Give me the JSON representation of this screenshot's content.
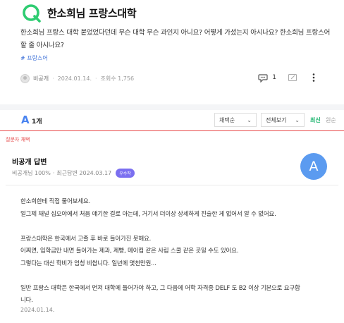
{
  "question": {
    "title": "한소희님 프랑스대학",
    "body": "한소희님 프랑스 대학 붙었었다던데 무슨 대학 무슨 과인지 아니요? 어떻게 가셨는지 아시나요? 한소희님 프랑스어할 줄 아시나요?",
    "tag": "# 프랑스어",
    "author": "비공개",
    "date": "2024.01.14.",
    "views": "조회수 1,756",
    "comment_count": "1"
  },
  "answers_header": {
    "letter": "A",
    "count": "1개",
    "select_sort": "채택순",
    "select_filter": "전체보기",
    "sort_latest": "최신",
    "sort_original": "원순"
  },
  "answer": {
    "chosen_label": "질문자 채택",
    "author_title": "비공개 답변",
    "adoption_rate": "비공개님 100%",
    "recent_answer": "최근답변 2024.03.17",
    "badge": "우수작",
    "avatar_letter": "A",
    "lines": [
      "한소희한테 직접 물어보세요.",
      "얼그제 채널 십오야에서 처음 얘기한 걸로 아는데, 거기서 더이상 상세하게 진술한 게 없어서 알 수 없어요.",
      "",
      "프랑스대학은 한국에서 고졸 후 바로 들어가진 못해요.",
      "어찌면, 입학금만 내면 들어가는 제과, 제빵, 메이컵 같은 사립 스쿨 같은 곳일 수도 있어요.",
      "그렇다는 대신 학비가 엄청 비쌉니다. 일년에 몇천만원...",
      "",
      "일반 프랑스 대학은 한국에서 먼저 대학에 들어가야 하고, 그 다음에 어학 자격증 DELF 도 B2 이상 기본으로 요구합",
      "니다."
    ],
    "date": "2024.01.14."
  },
  "colors": {
    "logo_green": "#2ecc71",
    "accent_blue": "#4a84f0",
    "chosen_red": "#e84b4b",
    "latest_green": "#17b36b",
    "badge_purple": "#7b6ff0"
  }
}
